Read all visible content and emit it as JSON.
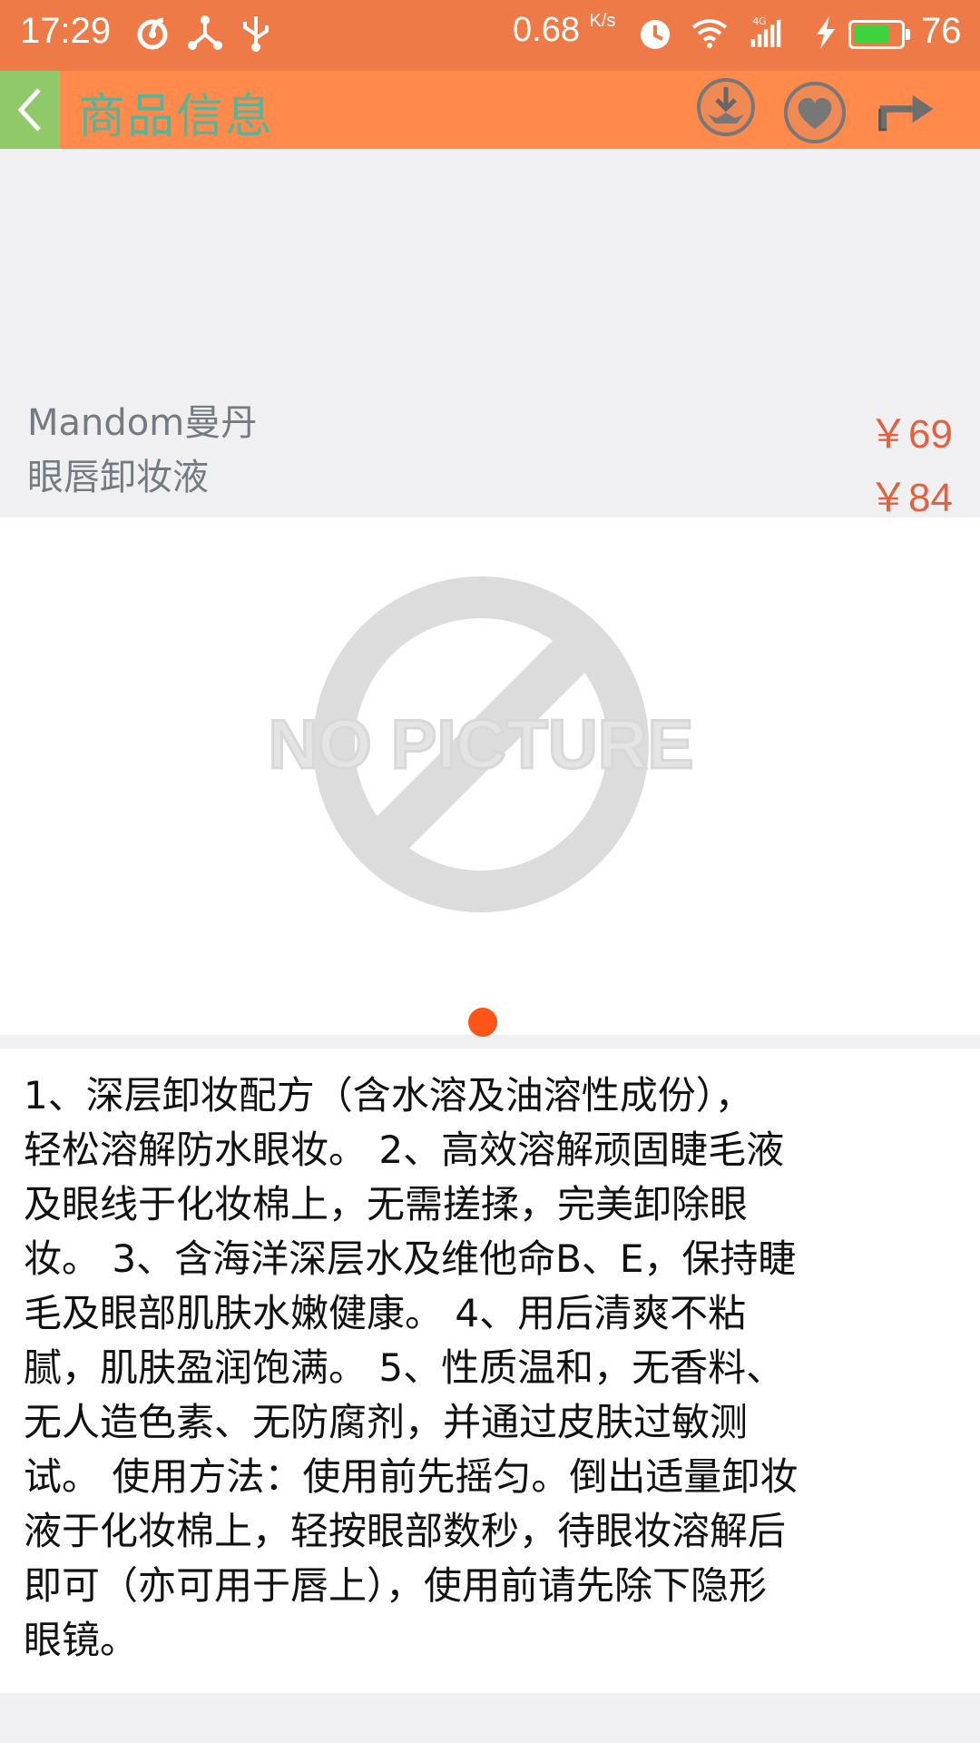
{
  "status_bar": {
    "time": "17:29",
    "net_speed": "0.68",
    "net_speed_unit": "K/s",
    "network_type": "4G",
    "battery_level": "76",
    "battery_fraction": 0.76,
    "icons": [
      "netease-cloud-music-icon",
      "share-nodes-icon",
      "usb-icon",
      "alarm-icon",
      "wifi-icon",
      "signal-icon",
      "charging-icon",
      "battery-icon"
    ]
  },
  "toolbar": {
    "title": "商品信息",
    "icons": [
      "back-arrow-icon",
      "download-icon",
      "favorite-heart-icon",
      "share-icon"
    ],
    "back_color": "#8fc96a",
    "bg_color": "#ff8a4c",
    "title_color": "#55b49a"
  },
  "product": {
    "name_line1": "Mandom曼丹",
    "name_line2": "眼唇卸妆液",
    "price_current": "￥69",
    "price_original": "￥84",
    "price_color": "#e06242"
  },
  "gallery": {
    "placeholder_text": "NO PICTURE",
    "pages": 1,
    "active_page": 1,
    "indicator_color": "#ff5418"
  },
  "description": {
    "text": "1、深层卸妆配方（含水溶及油溶性成份），\n轻松溶解防水眼妆。 2、高效溶解顽固睫毛液\n及眼线于化妆棉上，无需搓揉，完美卸除眼\n妆。 3、含海洋深层水及维他命B、E，保持睫\n毛及眼部肌肤水嫩健康。 4、用后清爽不粘\n腻，肌肤盈润饱满。 5、性质温和，无香料、\n无人造色素、无防腐剂，并通过皮肤过敏测\n试。 使用方法：使用前先摇匀。倒出适量卸妆\n液于化妆棉上，轻按眼部数秒，待眼妆溶解后\n即可（亦可用于唇上），使用前请先除下隐形\n眼镜。"
  }
}
